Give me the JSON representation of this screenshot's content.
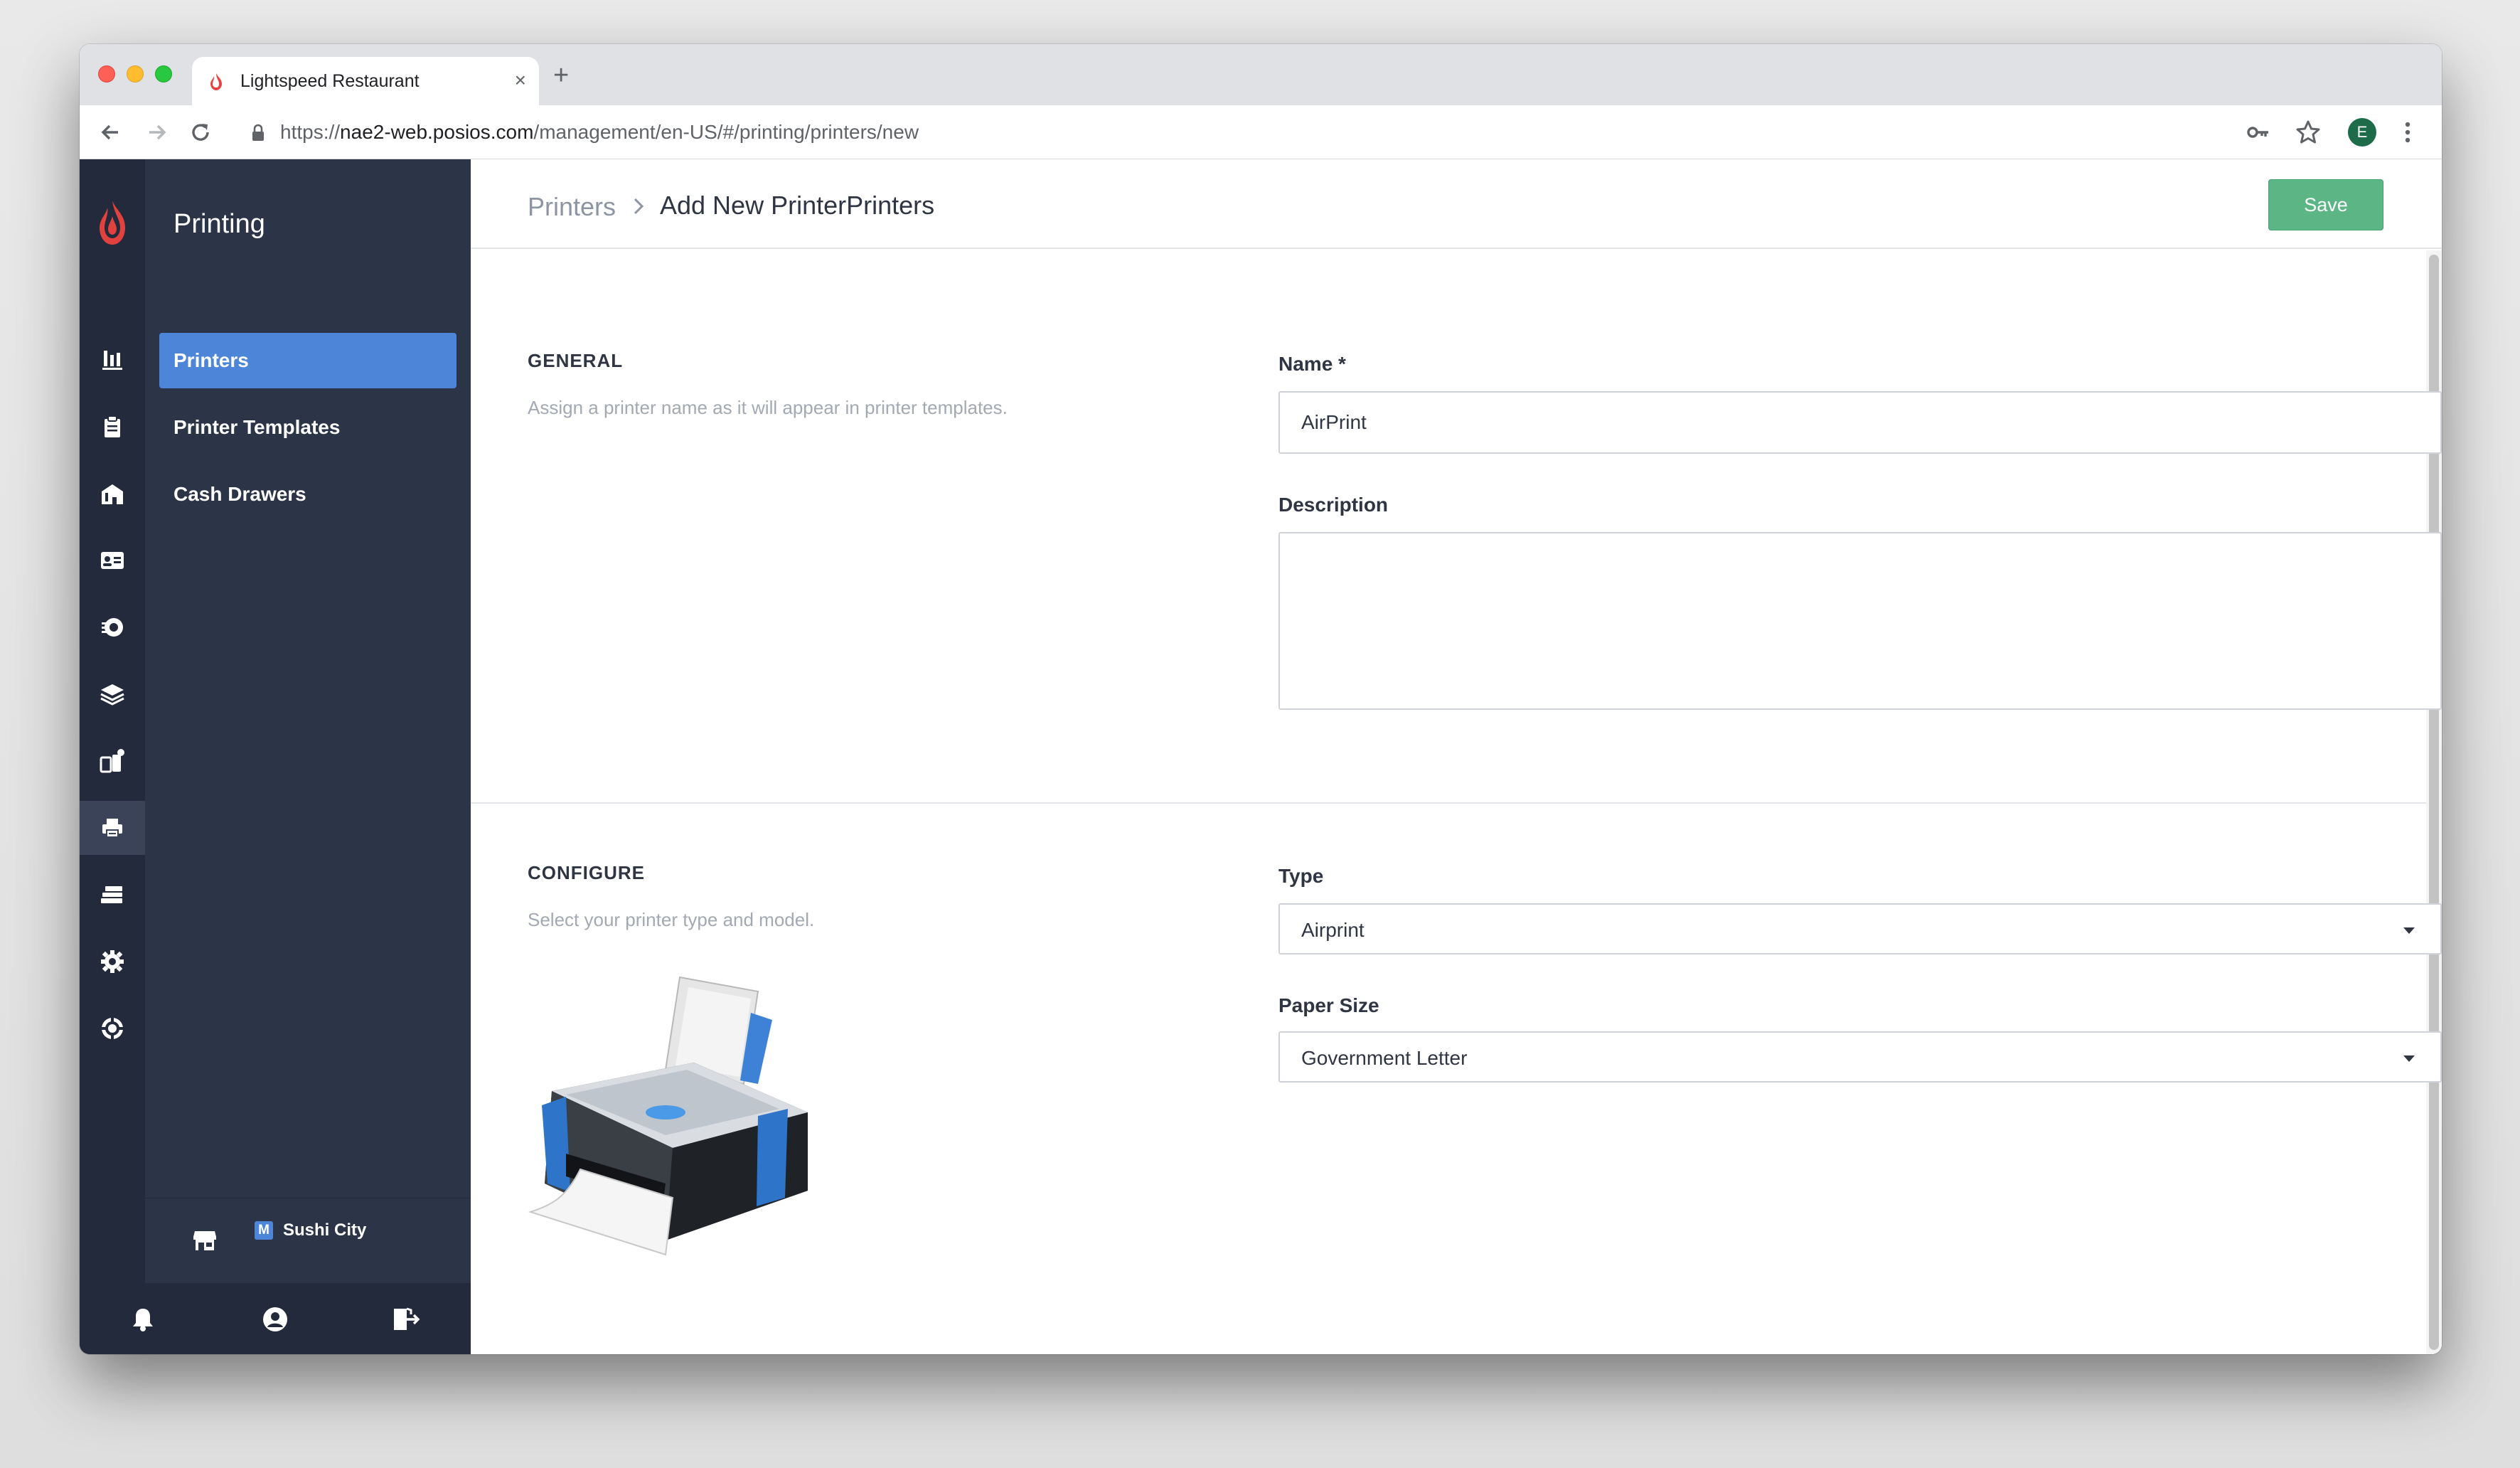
{
  "browser": {
    "tab_title": "Lightspeed Restaurant",
    "tab_close": "×",
    "new_tab": "+",
    "url_prefix": "https://",
    "url_host": "nae2-web.posios.com",
    "url_path": "/management/en-US/#/printing/printers/new",
    "profile_initial": "E"
  },
  "sidebar": {
    "section_title": "Printing",
    "items": [
      {
        "label": "Printers",
        "active": true
      },
      {
        "label": "Printer Templates",
        "active": false
      },
      {
        "label": "Cash Drawers",
        "active": false
      }
    ],
    "store": {
      "badge": "M",
      "name": "Sushi City"
    }
  },
  "rail_icons": [
    "reports-icon",
    "clipboard-icon",
    "store-icon",
    "id-card-icon",
    "dashboard-icon",
    "layers-icon",
    "devices-icon",
    "printer-icon",
    "cash-drawer-icon",
    "gear-icon",
    "help-icon"
  ],
  "header": {
    "breadcrumb_parent": "Printers",
    "breadcrumb_current": "Add New PrinterPrinters",
    "save_label": "Save"
  },
  "general": {
    "title": "GENERAL",
    "description": "Assign a printer name as it will appear in printer templates.",
    "name_label": "Name *",
    "name_value": "AirPrint",
    "description_label": "Description",
    "description_value": ""
  },
  "configure": {
    "title": "CONFIGURE",
    "description": "Select your printer type and model.",
    "type_label": "Type",
    "type_value": "Airprint",
    "paper_label": "Paper Size",
    "paper_value": "Government Letter"
  },
  "colors": {
    "rail_bg": "#222a3b",
    "sidebar_bg": "#2c3447",
    "active_item": "#4d86d9",
    "save_button": "#5bb585"
  }
}
